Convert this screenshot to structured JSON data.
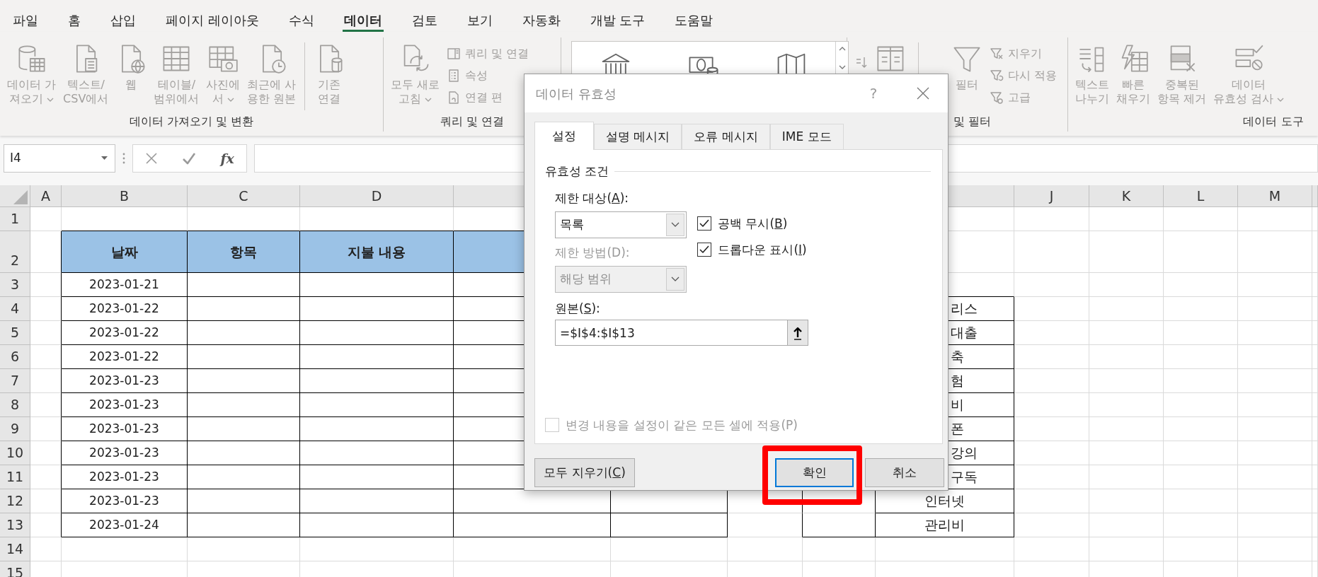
{
  "menu_tabs": [
    {
      "label": "파일",
      "selected": false
    },
    {
      "label": "홈",
      "selected": false
    },
    {
      "label": "삽입",
      "selected": false
    },
    {
      "label": "페이지 레이아웃",
      "selected": false
    },
    {
      "label": "수식",
      "selected": false
    },
    {
      "label": "데이터",
      "selected": true
    },
    {
      "label": "검토",
      "selected": false
    },
    {
      "label": "보기",
      "selected": false
    },
    {
      "label": "자동화",
      "selected": false
    },
    {
      "label": "개발 도구",
      "selected": false
    },
    {
      "label": "도움말",
      "selected": false
    }
  ],
  "ribbon_groups": [
    {
      "kind": "buttons",
      "label": "데이터 가져오기 및 변환",
      "items": [
        {
          "kind": "large",
          "label": "데이터 가\n져오기",
          "dropdown": true,
          "disabled": true
        },
        {
          "kind": "large",
          "label": "텍스트/\nCSV에서",
          "dropdown": false,
          "disabled": true
        },
        {
          "kind": "large",
          "label": "웹",
          "dropdown": false,
          "disabled": true
        },
        {
          "kind": "large",
          "label": "테이블/\n범위에서",
          "dropdown": false,
          "disabled": true
        },
        {
          "kind": "large",
          "label": "사진에\n서",
          "dropdown": true,
          "disabled": true
        },
        {
          "kind": "large",
          "label": "최근에 사\n용한 원본",
          "dropdown": false,
          "disabled": true
        }
      ],
      "extra_items": [
        {
          "kind": "large",
          "label": "기존\n연결",
          "dropdown": false,
          "disabled": true
        }
      ]
    },
    {
      "kind": "buttons",
      "label": "쿼리 및 연결",
      "items": [
        {
          "kind": "large",
          "label": "모두 새로\n고침",
          "dropdown": true,
          "disabled": true
        },
        {
          "kind": "small",
          "label": "쿼리 및 연결",
          "disabled": true
        },
        {
          "kind": "small",
          "label": "속성",
          "disabled": true
        },
        {
          "kind": "small",
          "label": "연결 편",
          "disabled": true
        }
      ]
    },
    {
      "kind": "gallery"
    },
    {
      "kind": "buttons",
      "label": "및 필터",
      "items": [
        {
          "kind": "icon",
          "disabled": true
        },
        {
          "kind": "icon",
          "disabled": true
        }
      ],
      "extra_items": [
        {
          "kind": "large",
          "label": "필터",
          "dropdown": false,
          "disabled": true
        },
        {
          "kind": "small",
          "label": "지우기",
          "disabled": true
        },
        {
          "kind": "small",
          "label": "다시 적용",
          "disabled": true
        },
        {
          "kind": "small",
          "label": "고급",
          "disabled": true
        }
      ]
    },
    {
      "kind": "buttons",
      "label": "데이터 도구",
      "items": [
        {
          "kind": "large",
          "label": "텍스트\n나누기",
          "dropdown": false,
          "disabled": true
        },
        {
          "kind": "large",
          "label": "빠른\n채우기",
          "dropdown": false,
          "disabled": true
        },
        {
          "kind": "large",
          "label": "중복된\n항목 제거",
          "dropdown": false,
          "disabled": true
        },
        {
          "kind": "large",
          "label": "데이터\n유효성 검사",
          "dropdown": true,
          "disabled": true
        }
      ]
    }
  ],
  "formula_bar": {
    "name_box": "I4",
    "function_label": "fx"
  },
  "sheet": {
    "column_headers": {
      "left": [
        "A",
        "B",
        "C",
        "D"
      ],
      "right": [
        "J",
        "K",
        "L",
        "M"
      ]
    },
    "row_headers": [
      "1",
      "2",
      "3",
      "4",
      "5",
      "6",
      "7",
      "8",
      "9",
      "10",
      "11",
      "12",
      "13",
      "14",
      "15"
    ],
    "table": {
      "headers": [
        "날짜",
        "항목",
        "지불 내용"
      ],
      "dates": [
        "2023-01-21",
        "2023-01-22",
        "2023-01-22",
        "2023-01-22",
        "2023-01-23",
        "2023-01-23",
        "2023-01-23",
        "2023-01-23",
        "2023-01-23",
        "2023-01-23",
        "2023-01-24"
      ]
    },
    "list": [
      "리스",
      "대출",
      "축",
      "험",
      "비",
      "폰",
      "강의",
      "구독",
      "인터넷",
      "관리비"
    ]
  },
  "dialog": {
    "title": "데이터 유효성",
    "help": "?",
    "tabs": [
      {
        "label": "설정",
        "selected": true
      },
      {
        "label": "설명 메시지",
        "selected": false
      },
      {
        "label": "오류 메시지",
        "selected": false
      },
      {
        "label": "IME 모드",
        "selected": false
      }
    ],
    "section_title": "유효성 조건",
    "allow_label": {
      "before": "제한 대상(",
      "key": "A",
      "after": "):"
    },
    "allow_value": "목록",
    "checkboxes": [
      {
        "before": "공백 무시(",
        "key": "B",
        "after": ")",
        "checked": true
      },
      {
        "before": "드롭다운 표시(",
        "key": "I",
        "after": ")",
        "checked": true
      }
    ],
    "data_label": {
      "text": "제한 방법(D):",
      "disabled": true
    },
    "data_value": {
      "value": "해당 범위",
      "disabled": true
    },
    "source_label": {
      "before": "원본(",
      "key": "S",
      "after": "):"
    },
    "source_value": "=$I$4:$I$13",
    "apply_all": {
      "label": "변경 내용을 설정이 같은 모든 셀에 적용(P)",
      "checked": false,
      "disabled": true
    },
    "buttons": [
      {
        "kind": "clear",
        "before": "모두 지우기(",
        "key": "C",
        "after": ")",
        "default": false,
        "highlighted": false
      },
      {
        "kind": "ok",
        "label": "확인",
        "default": true,
        "highlighted": true
      },
      {
        "kind": "cancel",
        "label": "취소",
        "default": false,
        "highlighted": false
      }
    ]
  }
}
